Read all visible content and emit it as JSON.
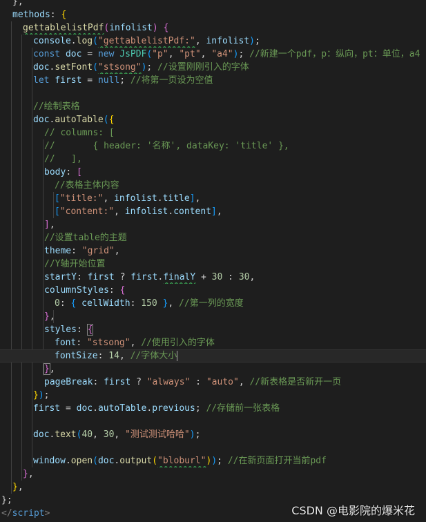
{
  "lines": [
    [
      [
        "pun",
        "},"
      ]
    ],
    [
      [
        "var",
        "methods"
      ],
      [
        "pun",
        ": "
      ],
      [
        "br1",
        "{"
      ]
    ],
    [
      [
        "fn",
        "gettablelistPdf",
        "wavy"
      ],
      [
        "br2",
        "("
      ],
      [
        "var",
        "infolist"
      ],
      [
        "br2",
        ")"
      ],
      [
        "pun",
        " "
      ],
      [
        "br2",
        "{"
      ]
    ],
    [
      [
        "var",
        "console"
      ],
      [
        "pun",
        "."
      ],
      [
        "fn",
        "log"
      ],
      [
        "br3",
        "("
      ],
      [
        "str",
        "\"gettablelistPdf:\"",
        "wavy"
      ],
      [
        "pun",
        ", "
      ],
      [
        "var",
        "infolist"
      ],
      [
        "br3",
        ")"
      ],
      [
        "pun",
        ";"
      ]
    ],
    [
      [
        "kw",
        "const "
      ],
      [
        "var",
        "doc"
      ],
      [
        "pun",
        " = "
      ],
      [
        "kw",
        "new "
      ],
      [
        "cls",
        "JsPDF"
      ],
      [
        "br3",
        "("
      ],
      [
        "str",
        "\"p\""
      ],
      [
        "pun",
        ", "
      ],
      [
        "str",
        "\"pt\""
      ],
      [
        "pun",
        ", "
      ],
      [
        "str",
        "\"a4\""
      ],
      [
        "br3",
        ")"
      ],
      [
        "pun",
        "; "
      ],
      [
        "cmt",
        "//新建一个pdf，p：纵向，pt：单位，a4"
      ]
    ],
    [
      [
        "var",
        "doc"
      ],
      [
        "pun",
        "."
      ],
      [
        "fn",
        "setFont"
      ],
      [
        "br3",
        "("
      ],
      [
        "str",
        "\"stsong\"",
        "wavy"
      ],
      [
        "br3",
        ")"
      ],
      [
        "pun",
        "; "
      ],
      [
        "cmt",
        "//设置刚刚引入的字体"
      ]
    ],
    [
      [
        "kw",
        "let "
      ],
      [
        "var",
        "first"
      ],
      [
        "pun",
        " = "
      ],
      [
        "kw",
        "null"
      ],
      [
        "pun",
        "; "
      ],
      [
        "cmt",
        "//将第一页设为空值"
      ]
    ],
    [],
    [
      [
        "cmt",
        "//绘制表格"
      ]
    ],
    [
      [
        "var",
        "doc"
      ],
      [
        "pun",
        "."
      ],
      [
        "fn",
        "autoTable"
      ],
      [
        "br3",
        "("
      ],
      [
        "br1",
        "{"
      ]
    ],
    [
      [
        "cmt",
        "// columns: ["
      ]
    ],
    [
      [
        "cmt",
        "//       { header: '名称', dataKey: 'title' },"
      ]
    ],
    [
      [
        "cmt",
        "//   ],"
      ]
    ],
    [
      [
        "var",
        "body"
      ],
      [
        "pun",
        ": "
      ],
      [
        "br2",
        "["
      ]
    ],
    [
      [
        "cmt",
        "//表格主体内容"
      ]
    ],
    [
      [
        "br3",
        "["
      ],
      [
        "str",
        "\"title:\""
      ],
      [
        "pun",
        ", "
      ],
      [
        "var",
        "infolist"
      ],
      [
        "pun",
        "."
      ],
      [
        "var",
        "title"
      ],
      [
        "br3",
        "]"
      ],
      [
        "pun",
        ","
      ]
    ],
    [
      [
        "br3",
        "["
      ],
      [
        "str",
        "\"content:\""
      ],
      [
        "pun",
        ", "
      ],
      [
        "var",
        "infolist"
      ],
      [
        "pun",
        "."
      ],
      [
        "var",
        "content"
      ],
      [
        "br3",
        "]"
      ],
      [
        "pun",
        ","
      ]
    ],
    [
      [
        "br2",
        "]"
      ],
      [
        "pun",
        ","
      ]
    ],
    [
      [
        "cmt",
        "//设置table的主题"
      ]
    ],
    [
      [
        "var",
        "theme"
      ],
      [
        "pun",
        ": "
      ],
      [
        "str",
        "\"grid\""
      ],
      [
        "pun",
        ","
      ]
    ],
    [
      [
        "cmt",
        "//Y轴开始位置"
      ]
    ],
    [
      [
        "var",
        "startY"
      ],
      [
        "pun",
        ": "
      ],
      [
        "var",
        "first"
      ],
      [
        "pun",
        " ? "
      ],
      [
        "var",
        "first"
      ],
      [
        "pun",
        "."
      ],
      [
        "var",
        "finalY",
        "wavy"
      ],
      [
        "pun",
        " + "
      ],
      [
        "num",
        "30"
      ],
      [
        "pun",
        " : "
      ],
      [
        "num",
        "30"
      ],
      [
        "pun",
        ","
      ]
    ],
    [
      [
        "var",
        "columnStyles"
      ],
      [
        "pun",
        ": "
      ],
      [
        "br2",
        "{"
      ]
    ],
    [
      [
        "num",
        "0"
      ],
      [
        "pun",
        ": "
      ],
      [
        "br3",
        "{"
      ],
      [
        "pun",
        " "
      ],
      [
        "var",
        "cellWidth"
      ],
      [
        "pun",
        ": "
      ],
      [
        "num",
        "150"
      ],
      [
        "pun",
        " "
      ],
      [
        "br3",
        "}"
      ],
      [
        "pun",
        ", "
      ],
      [
        "cmt",
        "//第一列的宽度"
      ]
    ],
    [
      [
        "br2",
        "}"
      ],
      [
        "pun",
        ","
      ]
    ],
    [
      [
        "var",
        "styles"
      ],
      [
        "pun",
        ": "
      ],
      [
        "br2",
        "{",
        "match"
      ]
    ],
    [
      [
        "var",
        "font"
      ],
      [
        "pun",
        ": "
      ],
      [
        "str",
        "\"stsong\""
      ],
      [
        "pun",
        ", "
      ],
      [
        "cmt",
        "//使用引入的字体"
      ]
    ],
    [
      [
        "var",
        "fontSize"
      ],
      [
        "pun",
        ": "
      ],
      [
        "num",
        "14"
      ],
      [
        "pun",
        ", "
      ],
      [
        "cmt",
        "//字体大小"
      ]
    ],
    [
      [
        "br2",
        "}",
        "match"
      ],
      [
        "pun",
        ","
      ]
    ],
    [
      [
        "var",
        "pageBreak"
      ],
      [
        "pun",
        ": "
      ],
      [
        "var",
        "first"
      ],
      [
        "pun",
        " ? "
      ],
      [
        "str",
        "\"always\""
      ],
      [
        "pun",
        " : "
      ],
      [
        "str",
        "\"auto\""
      ],
      [
        "pun",
        ", "
      ],
      [
        "cmt",
        "//新表格是否新开一页"
      ]
    ],
    [
      [
        "br1",
        "}"
      ],
      [
        "br3",
        ")"
      ],
      [
        "pun",
        ";"
      ]
    ],
    [
      [
        "var",
        "first"
      ],
      [
        "pun",
        " = "
      ],
      [
        "var",
        "doc"
      ],
      [
        "pun",
        "."
      ],
      [
        "var",
        "autoTable"
      ],
      [
        "pun",
        "."
      ],
      [
        "var",
        "previous"
      ],
      [
        "pun",
        "; "
      ],
      [
        "cmt",
        "//存储前一张表格"
      ]
    ],
    [],
    [
      [
        "var",
        "doc"
      ],
      [
        "pun",
        "."
      ],
      [
        "fn",
        "text"
      ],
      [
        "br3",
        "("
      ],
      [
        "num",
        "40"
      ],
      [
        "pun",
        ", "
      ],
      [
        "num",
        "30"
      ],
      [
        "pun",
        ", "
      ],
      [
        "str",
        "\"测试测试哈哈\""
      ],
      [
        "br3",
        ")"
      ],
      [
        "pun",
        ";"
      ]
    ],
    [],
    [
      [
        "var",
        "window"
      ],
      [
        "pun",
        "."
      ],
      [
        "fn",
        "open"
      ],
      [
        "br3",
        "("
      ],
      [
        "var",
        "doc"
      ],
      [
        "pun",
        "."
      ],
      [
        "fn",
        "output"
      ],
      [
        "br1",
        "("
      ],
      [
        "str",
        "\"bloburl\"",
        "wavy"
      ],
      [
        "br1",
        ")"
      ],
      [
        "br3",
        ")"
      ],
      [
        "pun",
        "; "
      ],
      [
        "cmt",
        "//在新页面打开当前pdf"
      ]
    ],
    [
      [
        "br2",
        "}"
      ],
      [
        "pun",
        ","
      ]
    ],
    [
      [
        "br1",
        "}"
      ],
      [
        "pun",
        ","
      ]
    ],
    [
      [
        "pun",
        "};"
      ]
    ],
    [
      [
        "tag",
        "</"
      ],
      [
        "tagname",
        "script"
      ],
      [
        "tag",
        ">"
      ]
    ]
  ],
  "watermark": "CSDN @电影院的爆米花"
}
